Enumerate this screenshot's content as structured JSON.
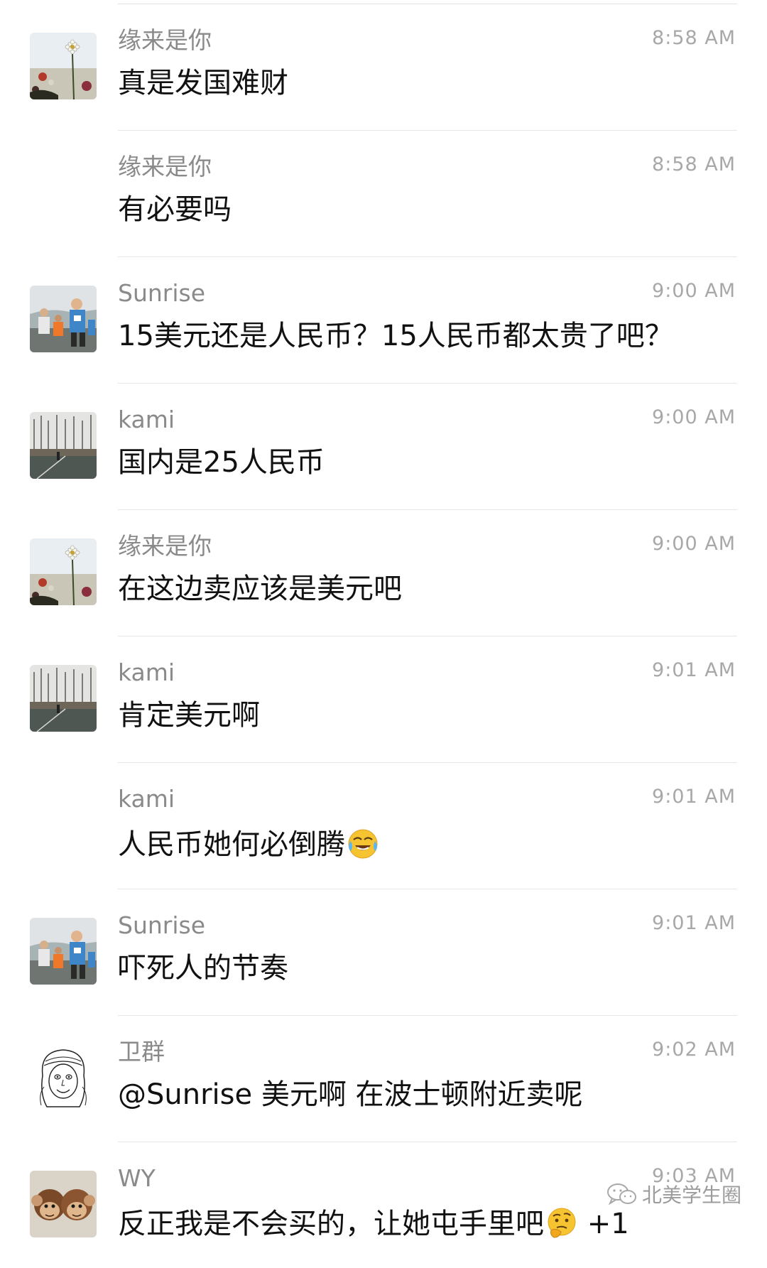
{
  "messages": [
    {
      "sender": "缘来是你",
      "time": "8:58 AM",
      "text": "真是发国难财",
      "avatar": "flower-avatar",
      "show_avatar": true
    },
    {
      "sender": "缘来是你",
      "time": "8:58 AM",
      "text": "有必要吗",
      "avatar": "flower-avatar",
      "show_avatar": false
    },
    {
      "sender": "Sunrise",
      "time": "9:00 AM",
      "text": "15美元还是人民币？15人民币都太贵了吧？",
      "avatar": "runners-avatar",
      "show_avatar": true
    },
    {
      "sender": "kami",
      "time": "9:00 AM",
      "text": "国内是25人民币",
      "avatar": "park-avatar",
      "show_avatar": true
    },
    {
      "sender": "缘来是你",
      "time": "9:00 AM",
      "text": "在这边卖应该是美元吧",
      "avatar": "flower-avatar",
      "show_avatar": true
    },
    {
      "sender": "kami",
      "time": "9:01 AM",
      "text": "肯定美元啊",
      "avatar": "park-avatar",
      "show_avatar": true
    },
    {
      "sender": "kami",
      "time": "9:01 AM",
      "text": "人民币她何必倒腾",
      "avatar": "park-avatar",
      "show_avatar": false,
      "emoji": "laughing-crying-emoji"
    },
    {
      "sender": "Sunrise",
      "time": "9:01 AM",
      "text": "吓死人的节奏",
      "avatar": "runners-avatar",
      "show_avatar": true
    },
    {
      "sender": "卫群",
      "time": "9:02 AM",
      "text": "@Sunrise 美元啊 在波士顿附近卖呢",
      "avatar": "sketch-avatar",
      "show_avatar": true
    },
    {
      "sender": "WY",
      "time": "9:03 AM",
      "text": "反正我是不会买的，让她屯手里吧",
      "avatar": "monkey-avatar",
      "show_avatar": true,
      "emoji": "thinking-emoji",
      "suffix": " +1"
    }
  ],
  "watermark": {
    "text": "北美学生圈",
    "icon": "wechat-icon"
  }
}
